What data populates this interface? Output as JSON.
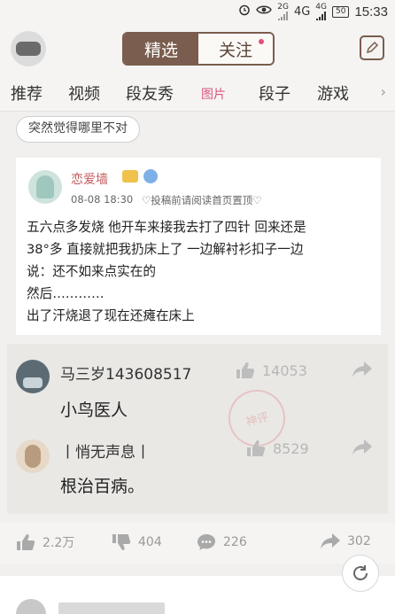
{
  "status_bar": {
    "net1_top": "2G",
    "net2": "4G",
    "net2_top": "4G",
    "battery": "50",
    "time": "15:33"
  },
  "header": {
    "tabs": [
      "精选",
      "关注"
    ],
    "active_tab": "精选"
  },
  "nav": {
    "items": [
      "推荐",
      "视频",
      "段友秀",
      "图片",
      "段子",
      "游戏"
    ],
    "active": "图片"
  },
  "topic_chip": "突然觉得哪里不对",
  "post": {
    "author": "恋爱墙",
    "date": "08-08 18:30",
    "note": "♡投稿前请阅读首页置顶♡",
    "lines": [
      "五六点多发烧 他开车来接我去打了四针 回来还是",
      "38°多 直接就把我扔床上了 一边解衬衫扣子一边",
      "说：还不如来点实在的",
      "然后…………",
      "出了汗烧退了现在还瘫在床上"
    ]
  },
  "comments": [
    {
      "name": "马三岁143608517",
      "likes": "14053",
      "text": "小鸟医人"
    },
    {
      "name": "丨悄无声息丨",
      "likes": "8529",
      "text": "根治百病。"
    }
  ],
  "stamp_text": "神评",
  "actions": {
    "likes": "2.2万",
    "dislikes": "404",
    "comments": "226",
    "shares": "302"
  },
  "icons": {
    "alarm": "alarm-icon",
    "eye": "eye-icon",
    "edit": "edit-icon",
    "thumb_up": "thumb-up-icon",
    "thumb_down": "thumb-down-icon",
    "comment": "comment-icon",
    "share": "share-icon",
    "refresh": "refresh-icon"
  },
  "colors": {
    "accent": "#d9577e",
    "brand_brown": "#7a5d4e"
  }
}
